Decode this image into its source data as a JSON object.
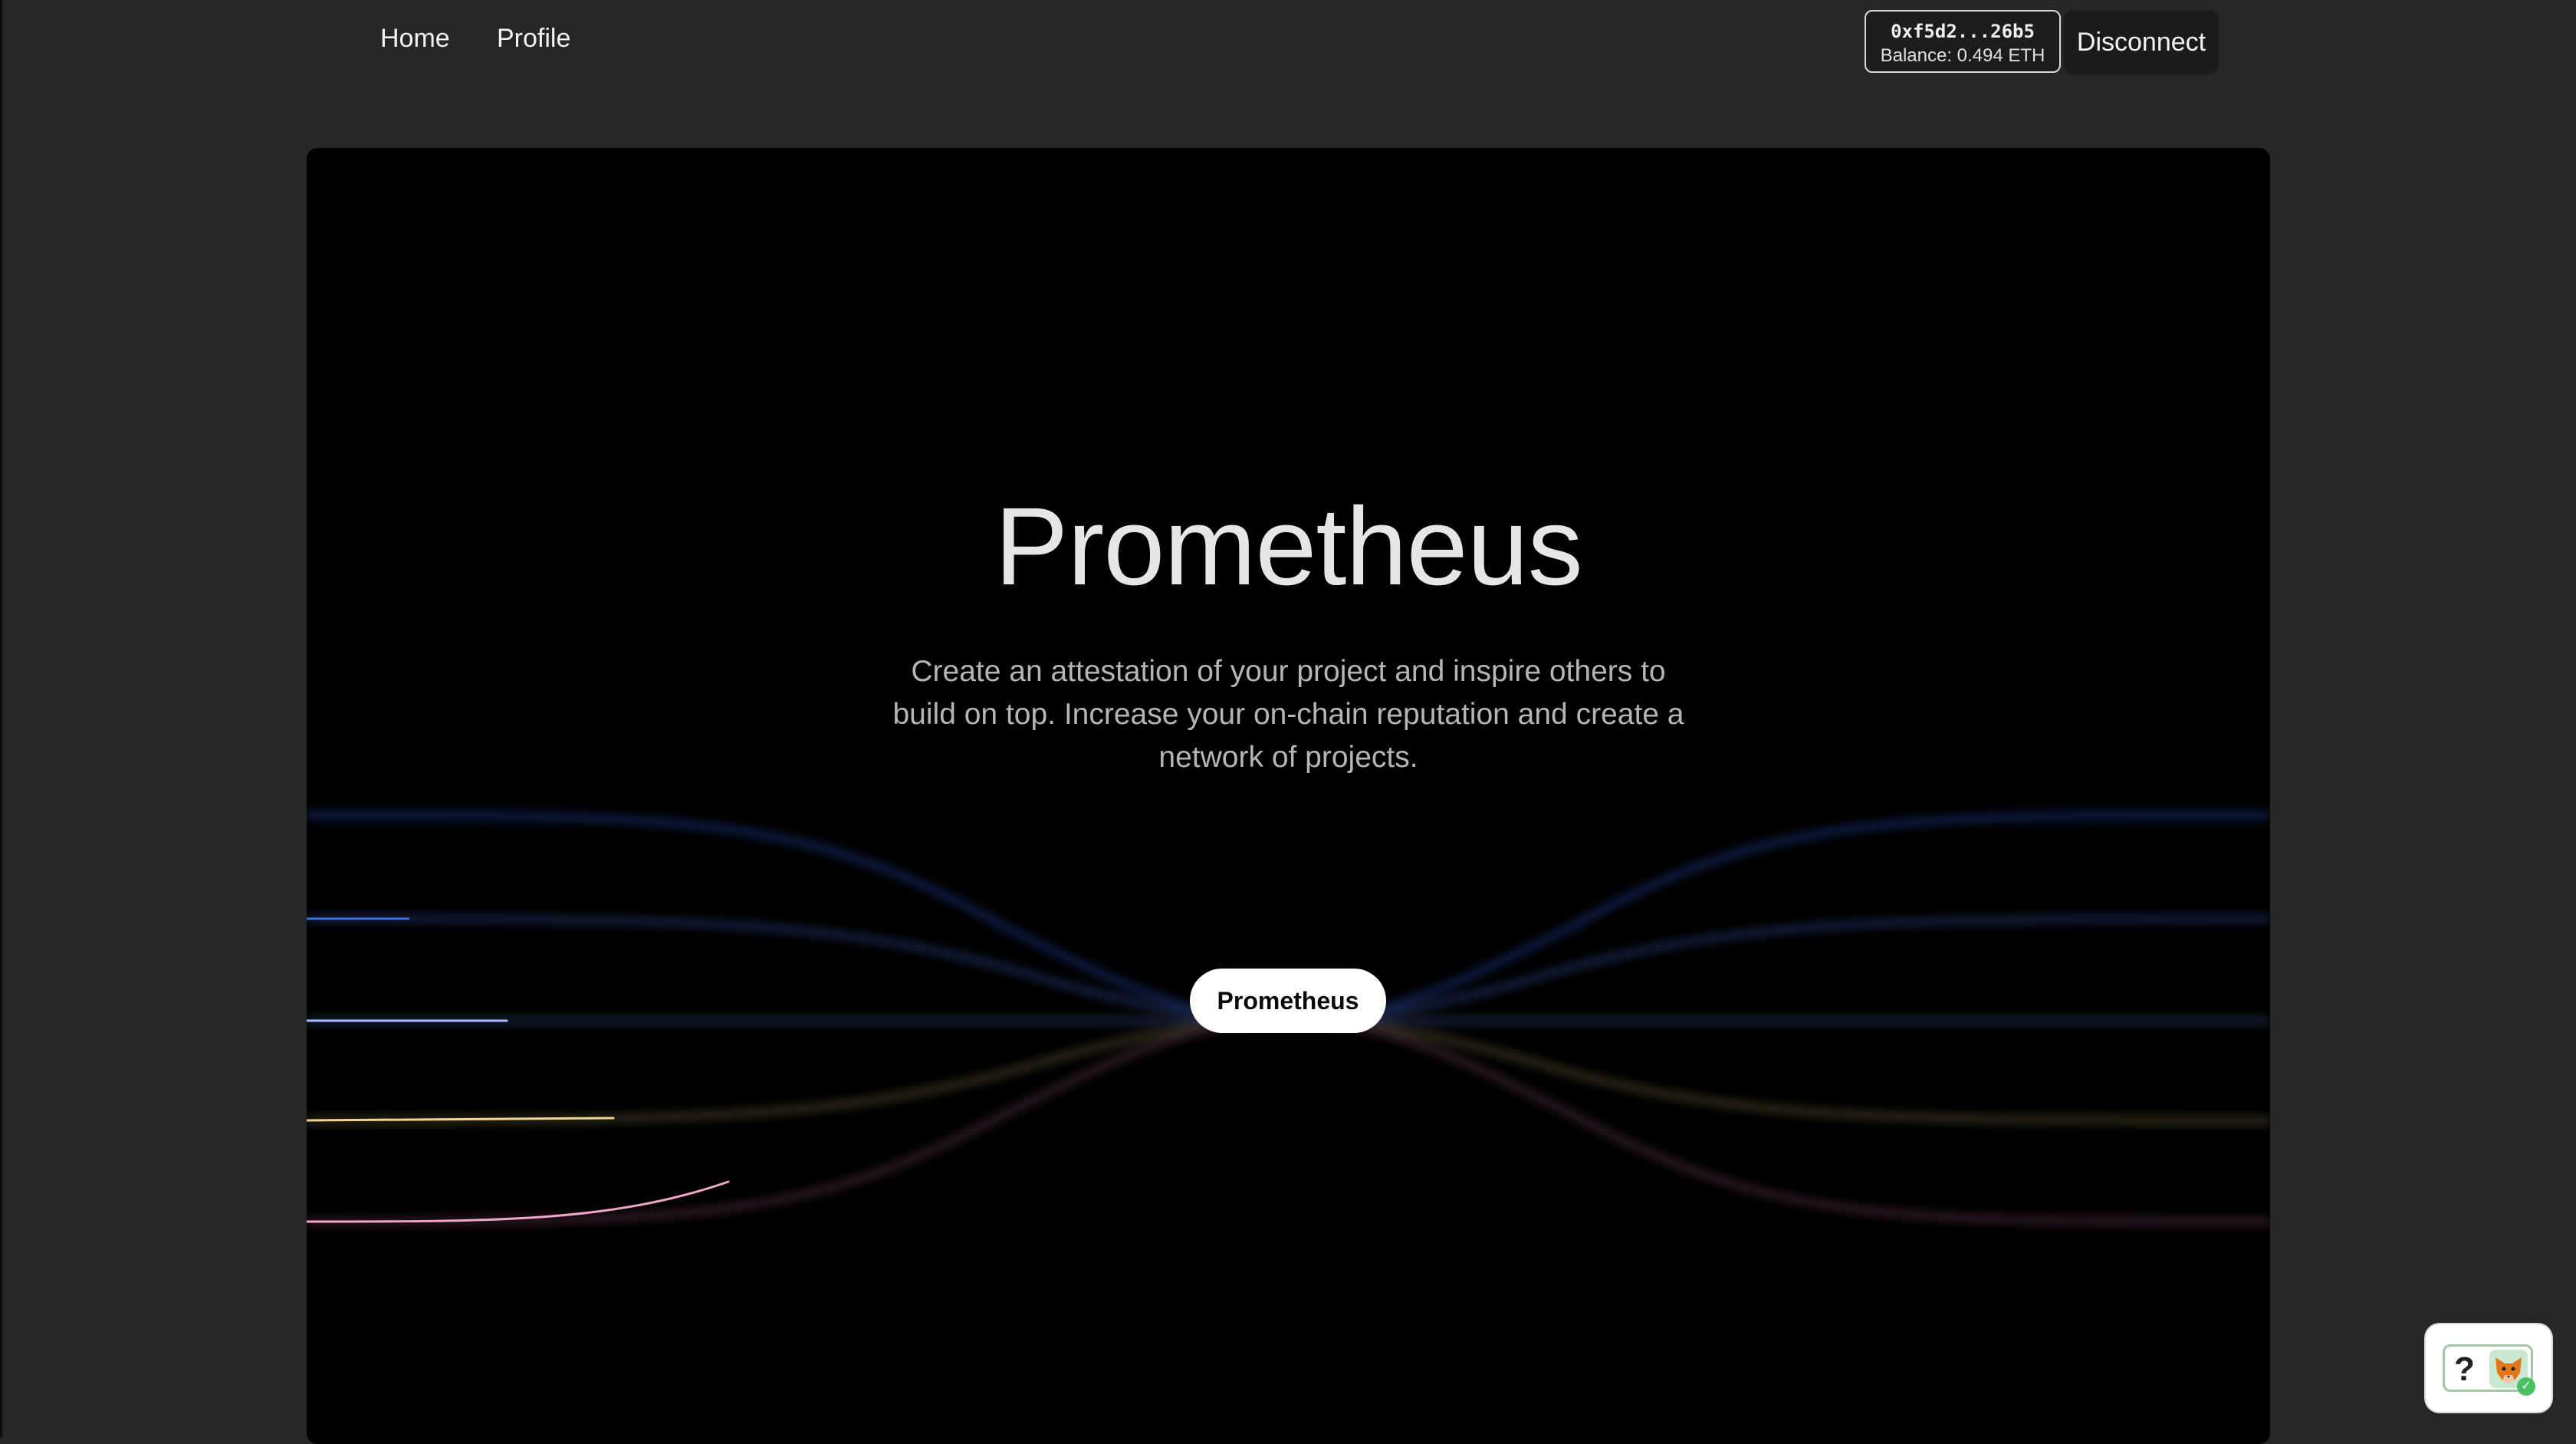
{
  "nav": {
    "home_label": "Home",
    "profile_label": "Profile"
  },
  "wallet": {
    "address": "0xf5d2...26b5",
    "balance": "Balance: 0.494 ETH",
    "disconnect_label": "Disconnect"
  },
  "hero": {
    "title": "Prometheus",
    "description": "Create an attestation of your project and inspire others to build on top. Increase your on-chain reputation and create a network of projects.",
    "cta_label": "Prometheus"
  },
  "help_widget": {
    "question_mark": "?",
    "icon": "metamask-fox-icon"
  },
  "colors": {
    "page_bg": "#262626",
    "hero_bg": "#000000",
    "line_blue": "#3d6fd8",
    "line_lavender": "#a9b8ff",
    "line_gold": "#f2d49a",
    "line_pink": "#f0a6c7"
  }
}
